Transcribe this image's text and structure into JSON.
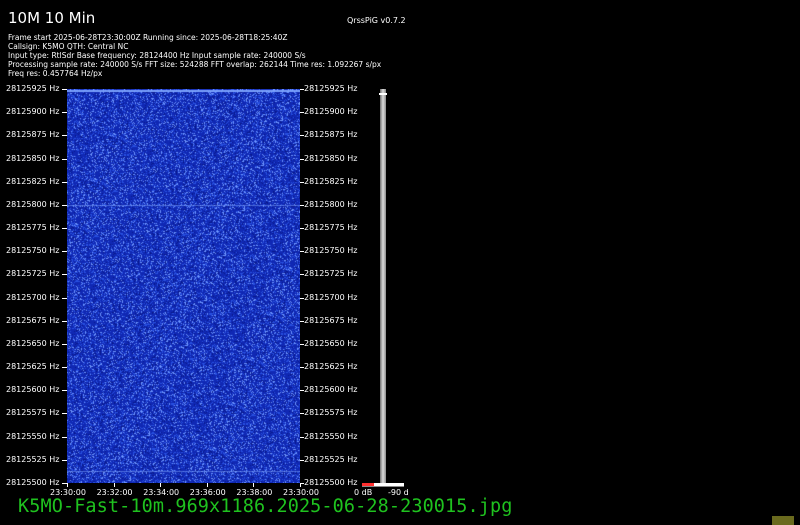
{
  "header": {
    "title": "10M 10 Min",
    "version": "QrssPiG v0.7.2",
    "info_lines": [
      "Frame start 2025-06-28T23:30:00Z Running since: 2025-06-28T18:25:40Z",
      "Callsign: K5MO QTH: Central NC",
      "Input type: RtlSdr Base frequency: 28124400 Hz Input sample rate: 240000 S/s",
      "Processing sample rate: 240000 S/s FFT size: 524288 FFT overlap: 262144 Time res: 1.092267 s/px",
      "Freq res: 0.457764 Hz/px"
    ]
  },
  "frequency_axis": {
    "labels": [
      "28125925 Hz",
      "28125900 Hz",
      "28125875 Hz",
      "28125850 Hz",
      "28125825 Hz",
      "28125800 Hz",
      "28125775 Hz",
      "28125750 Hz",
      "28125725 Hz",
      "28125700 Hz",
      "28125675 Hz",
      "28125650 Hz",
      "28125625 Hz",
      "28125600 Hz",
      "28125575 Hz",
      "28125550 Hz",
      "28125525 Hz",
      "28125500 Hz"
    ]
  },
  "time_axis": {
    "labels": [
      "23:30:00",
      "23:32:00",
      "23:34:00",
      "23:36:00",
      "23:38:00",
      "23:30:00"
    ]
  },
  "db_scale": {
    "min_label": "0 dB",
    "max_label": "-90 d"
  },
  "waterfall": {
    "background_color": "#1432b4",
    "signal_color": "#7fa6ff",
    "signal_lines_hz": [
      28125924,
      28125800,
      28125513
    ]
  },
  "footer": {
    "filename": "K5MO-Fast-10m.969x1186.2025-06-28-230015.jpg",
    "filename_color": "#1fc21f"
  }
}
